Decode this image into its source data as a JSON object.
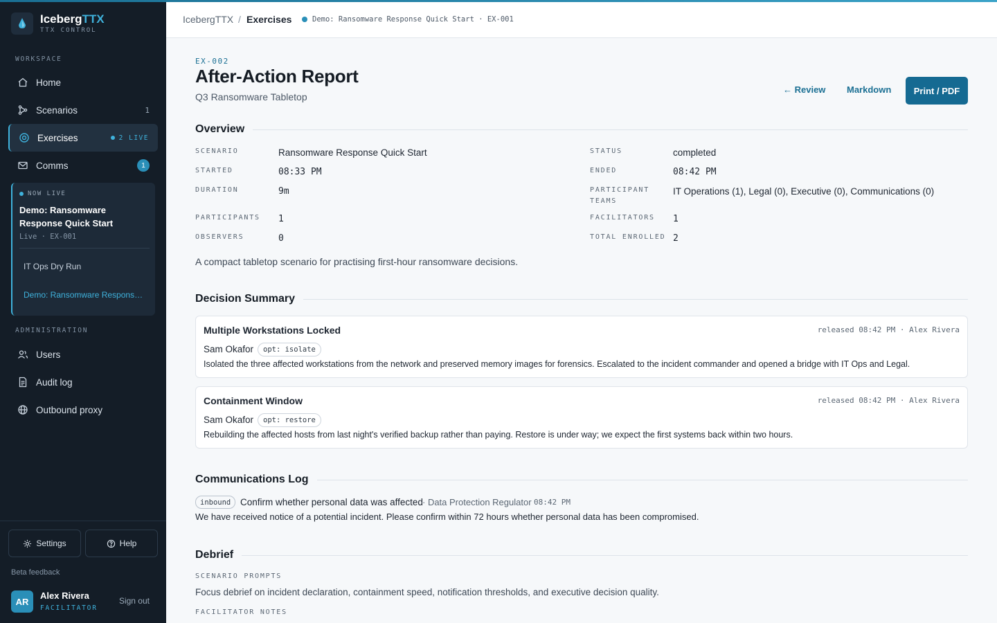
{
  "app": {
    "brand_prefix": "Iceberg",
    "brand_accent": "TTX",
    "brand_sub": "TTX CONTROL",
    "accent_color": "#3fb2dc",
    "primary_color": "#156a92"
  },
  "sidebar": {
    "workspace_label": "WORKSPACE",
    "admin_label": "ADMINISTRATION",
    "items": [
      {
        "label": "Home",
        "icon": "home-icon"
      },
      {
        "label": "Scenarios",
        "icon": "scenario-icon",
        "count": "1"
      },
      {
        "label": "Exercises",
        "icon": "target-icon",
        "live": "2 LIVE"
      },
      {
        "label": "Comms",
        "icon": "mail-icon",
        "badge": "1"
      }
    ],
    "live_card": {
      "status": "NOW LIVE",
      "title": "Demo: Ransomware Response Quick Start",
      "meta": "Live · EX-001",
      "sub_items": [
        "IT Ops Dry Run",
        "Demo: Ransomware Response Quick Start"
      ]
    },
    "admin_items": [
      {
        "label": "Users",
        "icon": "users-icon"
      },
      {
        "label": "Audit log",
        "icon": "document-icon"
      },
      {
        "label": "Outbound proxy",
        "icon": "globe-icon"
      }
    ],
    "settings_label": "Settings",
    "help_label": "Help",
    "beta_feedback": "Beta feedback",
    "user": {
      "initials": "AR",
      "name": "Alex Rivera",
      "role": "FACILITATOR"
    },
    "signout_label": "Sign out"
  },
  "topbar": {
    "crumb_root": "IcebergTTX",
    "crumb_sep": "/",
    "crumb_current": "Exercises",
    "live_exercise": "Demo: Ransomware Response Quick Start · EX-001"
  },
  "report": {
    "id": "EX-002",
    "title": "After-Action Report",
    "subtitle": "Q3 Ransomware Tabletop",
    "actions": {
      "review": "← Review",
      "markdown": "Markdown",
      "print": "Print / PDF"
    },
    "overview_heading": "Overview",
    "overview": {
      "scenario_k": "SCENARIO",
      "scenario_v": "Ransomware Response Quick Start",
      "status_k": "STATUS",
      "status_v": "completed",
      "started_k": "STARTED",
      "started_v": "08:33 PM",
      "ended_k": "ENDED",
      "ended_v": "08:42 PM",
      "duration_k": "DURATION",
      "duration_v": "9m",
      "teams_k1": "PARTICIPANT",
      "teams_k2": "TEAMS",
      "teams_v": "IT Operations (1), Legal (0), Executive (0), Communications (0)",
      "participants_k": "PARTICIPANTS",
      "participants_v": "1",
      "facilitators_k": "FACILITATORS",
      "facilitators_v": "1",
      "observers_k": "OBSERVERS",
      "observers_v": "0",
      "enrolled_k": "TOTAL ENROLLED",
      "enrolled_v": "2"
    },
    "description": "A compact tabletop scenario for practising first-hour ransomware decisions.",
    "decision_heading": "Decision Summary",
    "decisions": [
      {
        "title": "Multiple Workstations Locked",
        "meta": "released 08:42 PM · Alex Rivera",
        "who": "Sam Okafor",
        "option": "opt: isolate",
        "body": "Isolated the three affected workstations from the network and preserved memory images for forensics. Escalated to the incident commander and opened a bridge with IT Ops and Legal."
      },
      {
        "title": "Containment Window",
        "meta": "released 08:42 PM · Alex Rivera",
        "who": "Sam Okafor",
        "option": "opt: restore",
        "body": "Rebuilding the affected hosts from last night's verified backup rather than paying. Restore is under way; we expect the first systems back within two hours."
      }
    ],
    "comms_heading": "Communications Log",
    "comms": {
      "direction": "inbound",
      "title": "Confirm whether personal data was affected",
      "source": "· Data Protection Regulator",
      "time": "08:42 PM",
      "body": "We have received notice of a potential incident. Please confirm within 72 hours whether personal data has been compromised."
    },
    "debrief_heading": "Debrief",
    "debrief": {
      "prompts_label": "SCENARIO PROMPTS",
      "prompts_text": "Focus debrief on incident declaration, containment speed, notification thresholds, and executive decision quality.",
      "notes_label": "FACILITATOR NOTES"
    }
  }
}
